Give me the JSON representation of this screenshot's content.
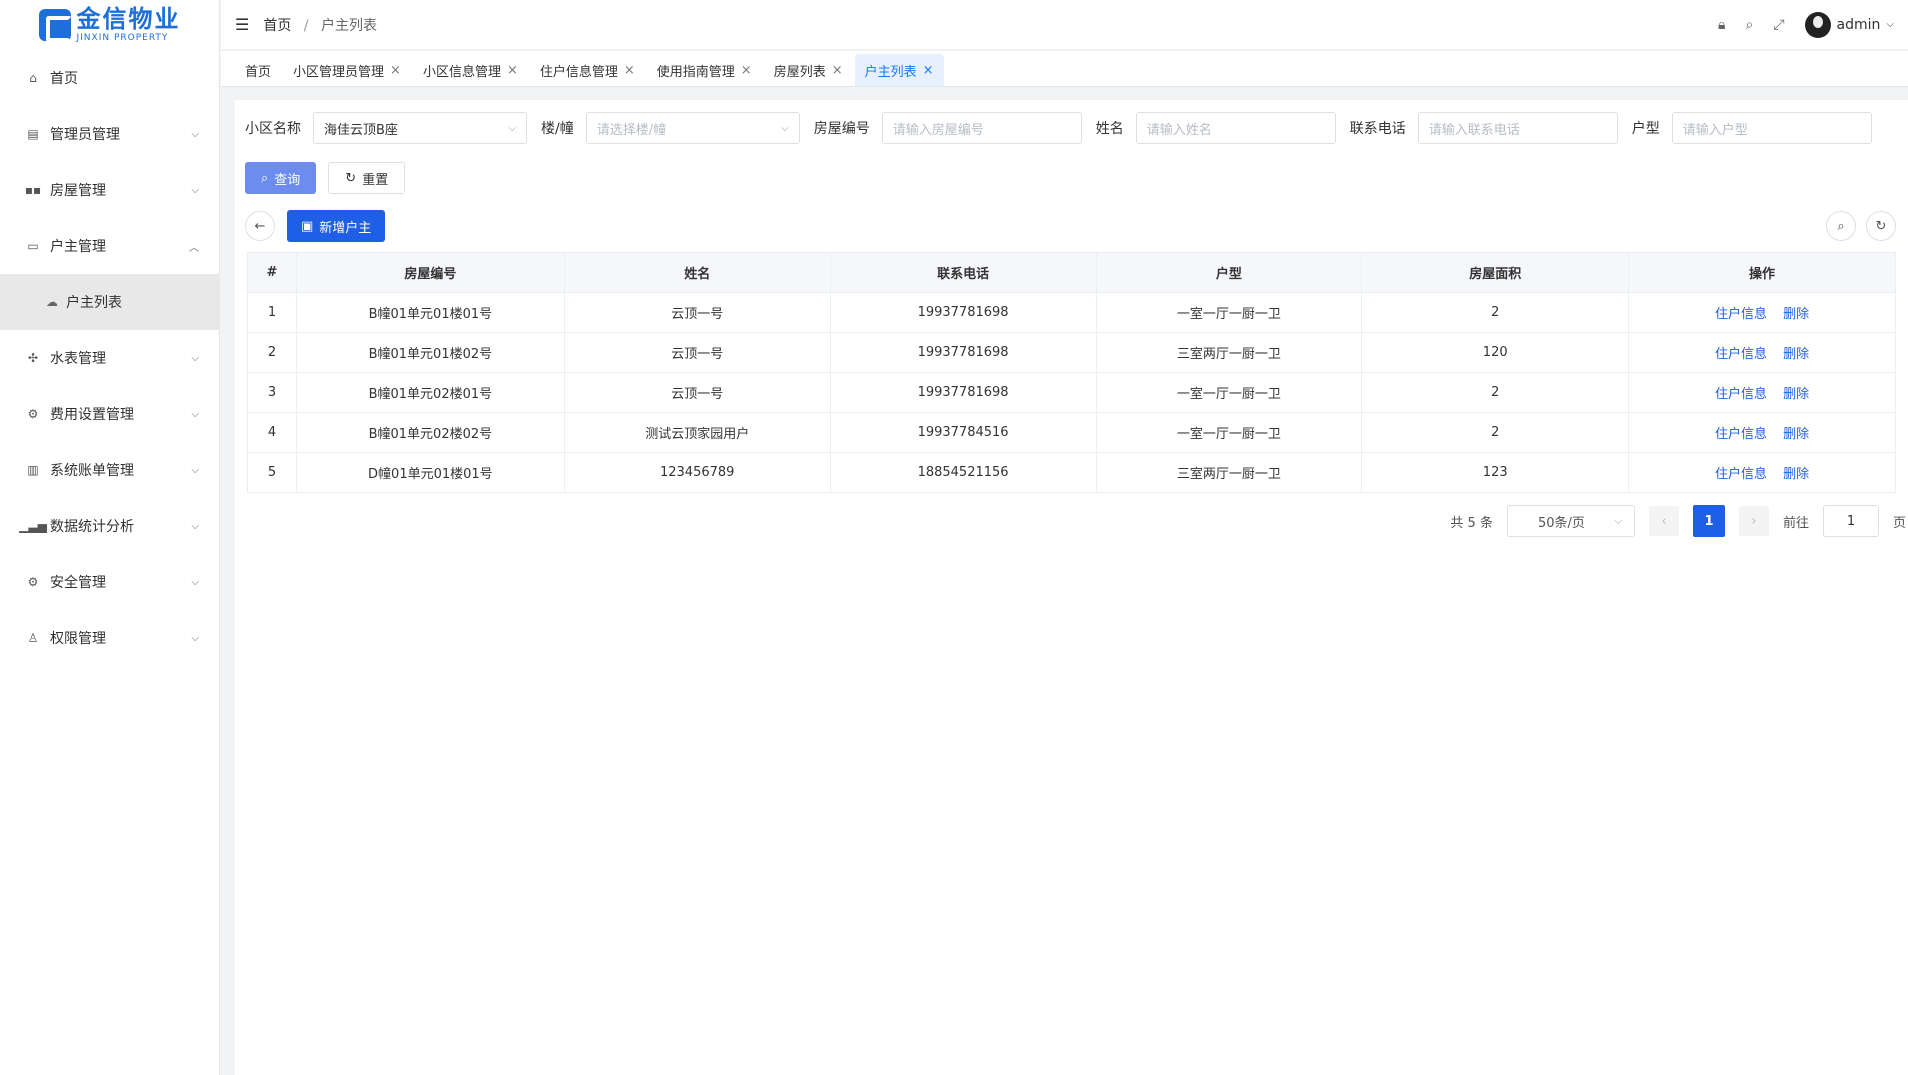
{
  "logo": {
    "cn": "金信物业",
    "en": "JINXIN PROPERTY"
  },
  "sidebar": {
    "items": [
      {
        "label": "首页",
        "icon": "home-icon"
      },
      {
        "label": "管理员管理",
        "icon": "document-icon"
      },
      {
        "label": "房屋管理",
        "icon": "grid-icon"
      },
      {
        "label": "户主管理",
        "icon": "monitor-icon"
      },
      {
        "label": "水表管理",
        "icon": "fan-icon"
      },
      {
        "label": "费用设置管理",
        "icon": "gear-icon"
      },
      {
        "label": "系统账单管理",
        "icon": "notebook-icon"
      },
      {
        "label": "数据统计分析",
        "icon": "bar-chart-icon"
      },
      {
        "label": "安全管理",
        "icon": "gear-icon"
      },
      {
        "label": "权限管理",
        "icon": "user-icon"
      }
    ],
    "subitem": {
      "label": "户主列表",
      "icon": "cloud-icon"
    }
  },
  "header": {
    "breadcrumb": [
      "首页",
      "户主列表"
    ],
    "separator": "/",
    "user": "admin"
  },
  "tabs": [
    {
      "label": "首页",
      "closable": false
    },
    {
      "label": "小区管理员管理",
      "closable": true
    },
    {
      "label": "小区信息管理",
      "closable": true
    },
    {
      "label": "住户信息管理",
      "closable": true
    },
    {
      "label": "使用指南管理",
      "closable": true
    },
    {
      "label": "房屋列表",
      "closable": true
    },
    {
      "label": "户主列表",
      "closable": true,
      "active": true
    }
  ],
  "filters": {
    "community_label": "小区名称",
    "community_value": "海佳云顶B座",
    "building_label": "楼/幢",
    "building_placeholder": "请选择楼/幢",
    "house_no_label": "房屋编号",
    "house_no_placeholder": "请输入房屋编号",
    "name_label": "姓名",
    "name_placeholder": "请输入姓名",
    "phone_label": "联系电话",
    "phone_placeholder": "请输入联系电话",
    "type_label": "户型",
    "type_placeholder": "请输入户型"
  },
  "buttons": {
    "query": "查询",
    "reset": "重置",
    "add": "新增户主"
  },
  "table": {
    "headers": [
      "#",
      "房屋编号",
      "姓名",
      "联系电话",
      "户型",
      "房屋面积",
      "操作"
    ],
    "rows": [
      {
        "idx": "1",
        "house": "B幢01单元01楼01号",
        "name": "云顶一号",
        "phone": "19937781698",
        "type": "一室一厅一厨一卫",
        "area": "2"
      },
      {
        "idx": "2",
        "house": "B幢01单元01楼02号",
        "name": "云顶一号",
        "phone": "19937781698",
        "type": "三室两厅一厨一卫",
        "area": "120"
      },
      {
        "idx": "3",
        "house": "B幢01单元02楼01号",
        "name": "云顶一号",
        "phone": "19937781698",
        "type": "一室一厅一厨一卫",
        "area": "2"
      },
      {
        "idx": "4",
        "house": "B幢01单元02楼02号",
        "name": "测试云顶家园用户",
        "phone": "19937784516",
        "type": "一室一厅一厨一卫",
        "area": "2"
      },
      {
        "idx": "5",
        "house": "D幢01单元01楼01号",
        "name": "123456789",
        "phone": "18854521156",
        "type": "三室两厅一厨一卫",
        "area": "123"
      }
    ],
    "action_info": "住户信息",
    "action_delete": "删除"
  },
  "pager": {
    "total": "共 5 条",
    "size": "50条/页",
    "current": "1",
    "goto_label": "前往",
    "goto_value": "1",
    "page_label": "页"
  },
  "colors": {
    "primary": "#1e5fe6",
    "query_button": "#6c8cf0",
    "active_tab_bg": "#e6f0ff"
  }
}
